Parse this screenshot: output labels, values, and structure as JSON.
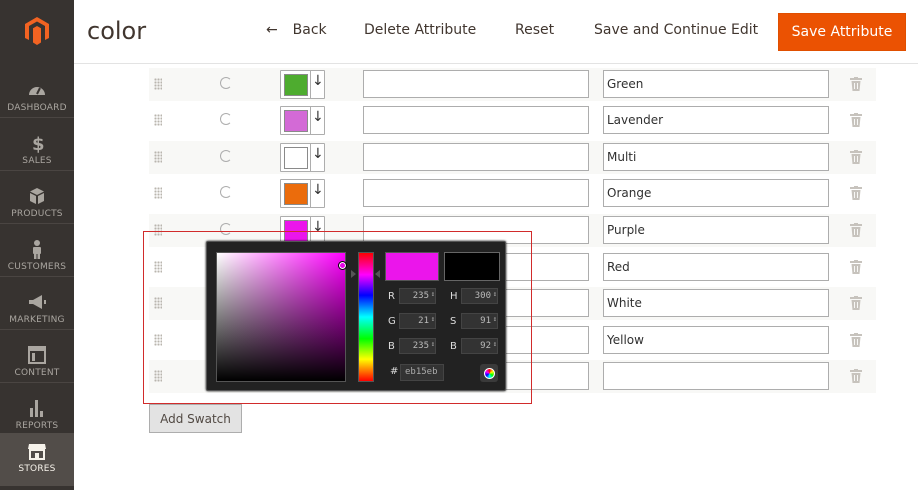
{
  "header": {
    "title": "color",
    "back_label": "Back",
    "delete_label": "Delete Attribute",
    "reset_label": "Reset",
    "save_continue_label": "Save and Continue Edit",
    "save_label": "Save Attribute"
  },
  "sidebar": {
    "items": [
      {
        "label": "DASHBOARD",
        "icon": "dashboard-icon"
      },
      {
        "label": "SALES",
        "icon": "dollar-icon"
      },
      {
        "label": "PRODUCTS",
        "icon": "box-icon"
      },
      {
        "label": "CUSTOMERS",
        "icon": "person-icon"
      },
      {
        "label": "MARKETING",
        "icon": "megaphone-icon"
      },
      {
        "label": "CONTENT",
        "icon": "layout-icon"
      },
      {
        "label": "REPORTS",
        "icon": "bar-chart-icon"
      },
      {
        "label": "STORES",
        "icon": "store-icon",
        "active": true
      }
    ]
  },
  "swatches": [
    {
      "label": "Green",
      "color": "#4eac2f",
      "visible_color": true
    },
    {
      "label": "Lavender",
      "color": "#d36ad6",
      "visible_color": true
    },
    {
      "label": "Multi",
      "color": "#ffffff",
      "visible_color": true
    },
    {
      "label": "Orange",
      "color": "#eb6c0c",
      "visible_color": true
    },
    {
      "label": "Purple",
      "color": "#eb15eb",
      "visible_color": true
    },
    {
      "label": "Red",
      "color": "#ffffff",
      "visible_color": false
    },
    {
      "label": "White",
      "color": "#ffffff",
      "visible_color": false
    },
    {
      "label": "Yellow",
      "color": "#ffffff",
      "visible_color": false
    },
    {
      "label": "",
      "color": "#ffffff",
      "visible_color": false
    }
  ],
  "add_swatch_label": "Add Swatch",
  "color_picker": {
    "new_color": "#eb15eb",
    "current_color": "#000000",
    "r_label": "R",
    "r": "235",
    "g_label": "G",
    "g": "21",
    "b_label": "B",
    "b": "235",
    "h_label": "H",
    "h": "300",
    "s_label": "S",
    "s": "91",
    "br_label": "B",
    "br": "92",
    "hex_label": "#",
    "hex": "eb15eb"
  },
  "colors": {
    "accent": "#eb5202",
    "sidebar_bg": "#373330",
    "highlight_outline": "#d12b2b"
  }
}
